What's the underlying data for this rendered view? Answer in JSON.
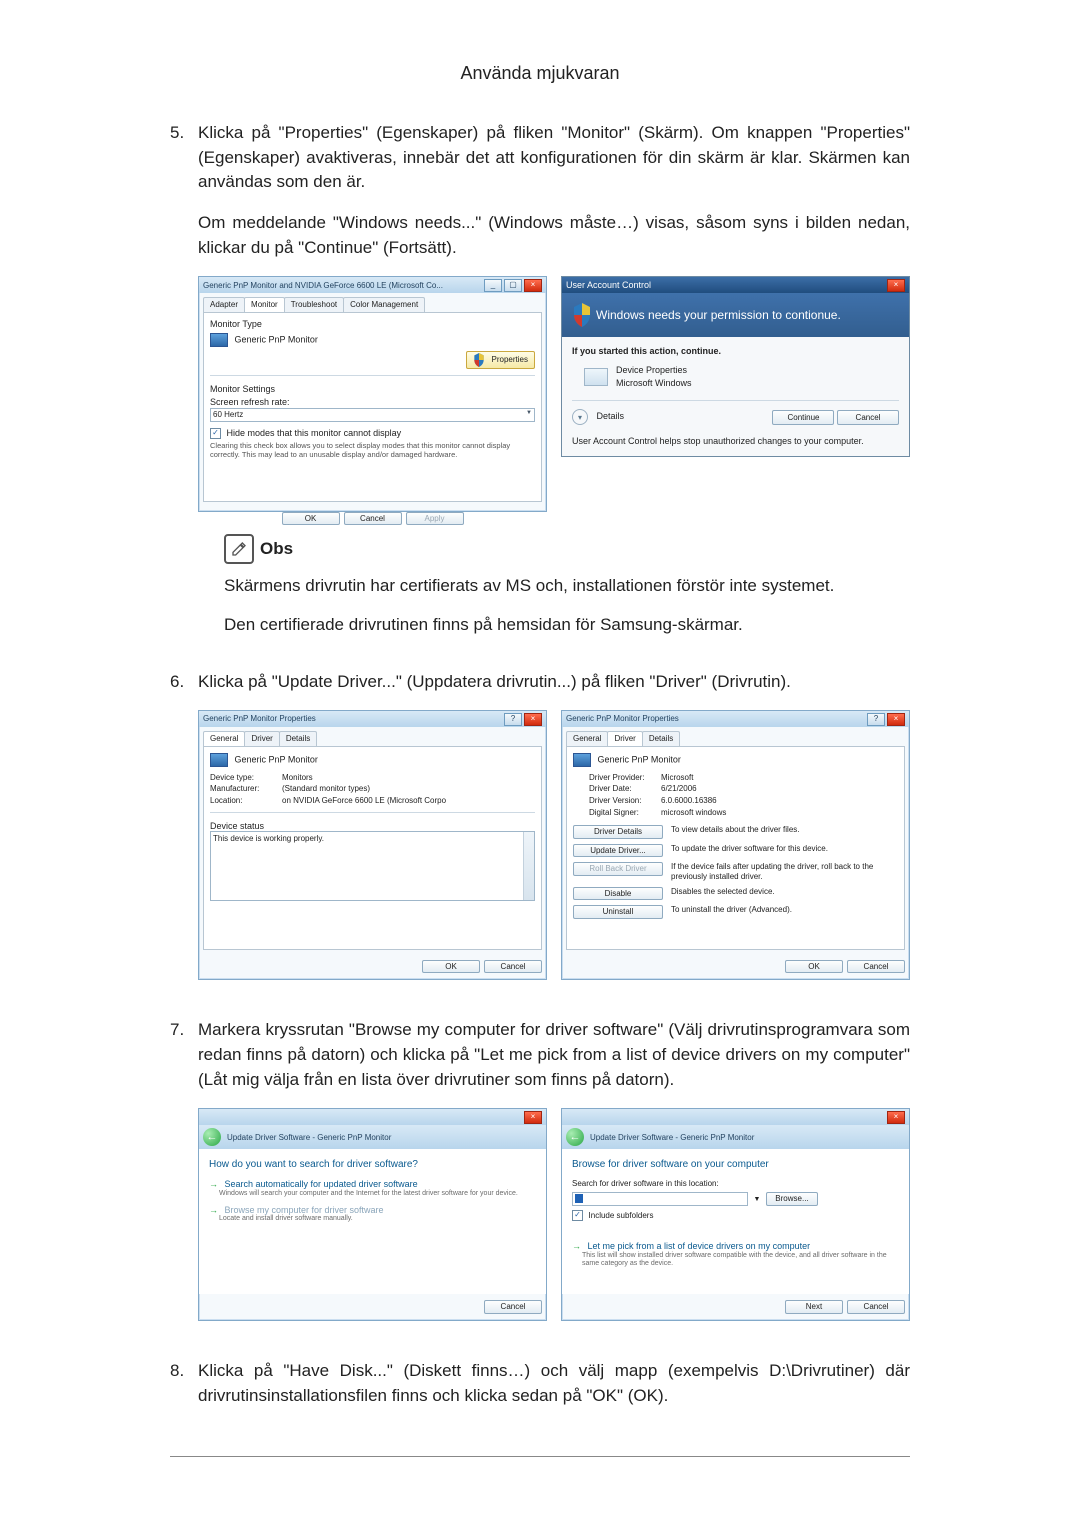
{
  "header": "Använda mjukvaran",
  "steps": {
    "s5": {
      "num": "5.",
      "p1": "Klicka på \"Properties\" (Egenskaper) på fliken \"Monitor\" (Skärm). Om knappen \"Properties\" (Egenskaper) avaktiveras, innebär det att konfigurationen för din skärm är klar. Skärmen kan användas som den är.",
      "p2": "Om meddelande \"Windows needs...\" (Windows måste…) visas, såsom syns i bilden nedan, klickar du på \"Continue\" (Fortsätt)."
    },
    "s6": {
      "num": "6.",
      "p1": "Klicka på \"Update Driver...\" (Uppdatera drivrutin...) på fliken \"Driver\" (Drivrutin)."
    },
    "s7": {
      "num": "7.",
      "p1": "Markera kryssrutan \"Browse my computer for driver software\" (Välj drivrutinsprogramvara som redan finns på datorn) och klicka på \"Let me pick from a list of device drivers on my computer\" (Låt mig välja från en lista över drivrutiner som finns på datorn)."
    },
    "s8": {
      "num": "8.",
      "p1": "Klicka på \"Have Disk...\" (Diskett finns…) och välj mapp (exempelvis D:\\Drivrutiner) där drivrutinsinstallationsfilen finns och klicka sedan på \"OK\" (OK)."
    }
  },
  "note": {
    "title": "Obs",
    "p1": "Skärmens drivrutin har certifierats av MS och, installationen förstör inte systemet.",
    "p2": "Den certifierade drivrutinen finns på hemsidan för Samsung-skärmar."
  },
  "monitorDlg": {
    "title": "Generic PnP Monitor and NVIDIA GeForce 6600 LE (Microsoft Co...",
    "tabs": [
      "Adapter",
      "Monitor",
      "Troubleshoot",
      "Color Management"
    ],
    "monitorType": "Monitor Type",
    "monitorName": "Generic PnP Monitor",
    "propertiesBtn": "Properties",
    "settingsHead": "Monitor Settings",
    "refreshLbl": "Screen refresh rate:",
    "refreshVal": "60 Hertz",
    "hideChk": "Hide modes that this monitor cannot display",
    "hideHelp": "Clearing this check box allows you to select display modes that this monitor cannot display correctly. This may lead to an unusable display and/or damaged hardware.",
    "ok": "OK",
    "cancel": "Cancel",
    "apply": "Apply"
  },
  "uac": {
    "title": "User Account Control",
    "perm": "Windows needs your permission to contionue.",
    "started": "If you started this action, continue.",
    "item": "Device Properties",
    "vendor": "Microsoft Windows",
    "details": "Details",
    "continue": "Continue",
    "cancel": "Cancel",
    "foot": "User Account Control helps stop unauthorized changes to your computer."
  },
  "propGeneral": {
    "title": "Generic PnP Monitor Properties",
    "tabs": [
      "General",
      "Driver",
      "Details"
    ],
    "name": "Generic PnP Monitor",
    "kv": {
      "deviceTypeK": "Device type:",
      "deviceTypeV": "Monitors",
      "manufacturerK": "Manufacturer:",
      "manufacturerV": "(Standard monitor types)",
      "locationK": "Location:",
      "locationV": "on NVIDIA GeForce 6600 LE (Microsoft Corpo"
    },
    "statusHead": "Device status",
    "statusText": "This device is working properly.",
    "ok": "OK",
    "cancel": "Cancel"
  },
  "propDriver": {
    "title": "Generic PnP Monitor Properties",
    "tabs": [
      "General",
      "Driver",
      "Details"
    ],
    "name": "Generic PnP Monitor",
    "kv": {
      "providerK": "Driver Provider:",
      "providerV": "Microsoft",
      "dateK": "Driver Date:",
      "dateV": "6/21/2006",
      "versionK": "Driver Version:",
      "versionV": "6.0.6000.16386",
      "signerK": "Digital Signer:",
      "signerV": "microsoft windows"
    },
    "btns": {
      "details": {
        "label": "Driver Details",
        "desc": "To view details about the driver files."
      },
      "update": {
        "label": "Update Driver...",
        "desc": "To update the driver software for this device."
      },
      "rollback": {
        "label": "Roll Back Driver",
        "desc": "If the device fails after updating the driver, roll back to the previously installed driver."
      },
      "disable": {
        "label": "Disable",
        "desc": "Disables the selected device."
      },
      "uninstall": {
        "label": "Uninstall",
        "desc": "To uninstall the driver (Advanced)."
      }
    },
    "ok": "OK",
    "cancel": "Cancel"
  },
  "wiz1": {
    "crumb": "Update Driver Software - Generic PnP Monitor",
    "heading": "How do you want to search for driver software?",
    "opt1": {
      "title": "Search automatically for updated driver software",
      "sub": "Windows will search your computer and the Internet for the latest driver software for your device."
    },
    "opt2": {
      "title": "Browse my computer for driver software",
      "sub": "Locate and install driver software manually."
    },
    "cancel": "Cancel"
  },
  "wiz2": {
    "crumb": "Update Driver Software - Generic PnP Monitor",
    "heading": "Browse for driver software on your computer",
    "searchLbl": "Search for driver software in this location:",
    "browse": "Browse...",
    "includeChk": "Include subfolders",
    "opt": {
      "title": "Let me pick from a list of device drivers on my computer",
      "sub": "This list will show installed driver software compatible with the device, and all driver software in the same category as the device."
    },
    "next": "Next",
    "cancel": "Cancel"
  }
}
